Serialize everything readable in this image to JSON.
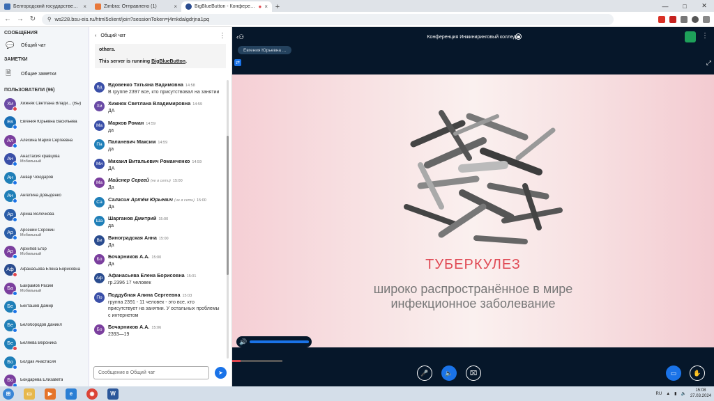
{
  "browser": {
    "tabs": [
      {
        "label": "Белгородский государственны",
        "color": "#3b6db3"
      },
      {
        "label": "Zimbra: Отправлено (1)",
        "color": "#e8783a"
      },
      {
        "label": "BigBlueButton - Конферен...",
        "color": "#2a4c8f"
      }
    ],
    "url": "ws228.bsu-eis.ru/html5client/join?sessionToken=j4mkdalgdrjna1pq"
  },
  "sidebar": {
    "messages_title": "СООБЩЕНИЯ",
    "public_chat": "Общий чат",
    "notes_title": "ЗАМЕТКИ",
    "shared_notes": "Общие заметки",
    "users_title": "ПОЛЬЗОВАТЕЛИ (96)",
    "users": [
      {
        "initials": "Хи",
        "name": "Хижняк Светлана Влади...  (Вы)",
        "sub": "",
        "color": "#6a4aa5",
        "dot": "#e0464d"
      },
      {
        "initials": "Ев",
        "name": "Евгения Юрьевна Васильева",
        "sub": "",
        "color": "#1a6fb5",
        "dot": "#1a73e8"
      },
      {
        "initials": "Ал",
        "name": "Алёхина Мария Сергеевна",
        "sub": "",
        "color": "#7b3f9e",
        "dot": "#1a73e8"
      },
      {
        "initials": "Ан",
        "name": "Анастасия кравцова",
        "sub": "Мобильный",
        "color": "#3a4fa8",
        "dot": "#1a73e8"
      },
      {
        "initials": "Ан",
        "name": "Анвар Чоюдаров",
        "sub": "",
        "color": "#1f7fb8",
        "dot": "#1a73e8"
      },
      {
        "initials": "Ан",
        "name": "Ангелина Довыденко",
        "sub": "",
        "color": "#1f7fb8",
        "dot": "#1a73e8"
      },
      {
        "initials": "Ар",
        "name": "Арина Волочкова",
        "sub": "",
        "color": "#2a5da8",
        "dot": "#1a73e8"
      },
      {
        "initials": "Ар",
        "name": "Арсений Сорокин",
        "sub": "Мобильный",
        "color": "#2a5da8",
        "dot": "#1a73e8"
      },
      {
        "initials": "Ар",
        "name": "Архипов Егор",
        "sub": "Мобильный",
        "color": "#7b3f9e",
        "dot": "#1a73e8"
      },
      {
        "initials": "Аф",
        "name": "Афанасьева Елена Борисовна",
        "sub": "",
        "color": "#2a4c8f",
        "dot": "#e0464d"
      },
      {
        "initials": "Ба",
        "name": "Байрамов Расим",
        "sub": "Мобильный",
        "color": "#7b3f9e",
        "dot": "#1a73e8"
      },
      {
        "initials": "Бе",
        "name": "Бекташев Дамир",
        "sub": "",
        "color": "#1f7fb8",
        "dot": "#1a73e8"
      },
      {
        "initials": "Бе",
        "name": "Белобородов Даниил",
        "sub": "",
        "color": "#1f7fb8",
        "dot": "#1a73e8"
      },
      {
        "initials": "Бе",
        "name": "Беляева Вероника",
        "sub": "",
        "color": "#1f7fb8",
        "dot": "#e0464d"
      },
      {
        "initials": "Бо",
        "name": "Болдак Анастасия",
        "sub": "",
        "color": "#1f7fb8",
        "dot": "#1a73e8"
      },
      {
        "initials": "Бо",
        "name": "Бондарева Елизавета",
        "sub": "",
        "color": "#7b3f9e",
        "dot": "#1a73e8"
      }
    ]
  },
  "chat": {
    "header": "Общий чат",
    "welcome_line1": "others.",
    "welcome_line2": "This server is running",
    "welcome_link": "BigBlueButton",
    "messages": [
      {
        "initials": "Вд",
        "name": "Вдовенко Татьяна Вадимовна",
        "offline": "",
        "time": "14:58",
        "text": "В группе 2397 все, кто присутствовал на занятии",
        "color": "#3a4fa8"
      },
      {
        "initials": "Хи",
        "name": "Хижняк Светлана Владимировна",
        "offline": "",
        "time": "14:59",
        "text": "ДА",
        "color": "#6a4aa5"
      },
      {
        "initials": "Ма",
        "name": "Марков Роман",
        "offline": "",
        "time": "14:59",
        "text": "да",
        "color": "#3a4fa8"
      },
      {
        "initials": "Па",
        "name": "Паланевич Максим",
        "offline": "",
        "time": "14:59",
        "text": "да",
        "color": "#1f7fb8"
      },
      {
        "initials": "Ми",
        "name": "Михаил Витальевич Романченко",
        "offline": "",
        "time": "14:59",
        "text": "ДА",
        "color": "#3a4fa8"
      },
      {
        "initials": "Ма",
        "name": "Майснер Сергей",
        "offline": "(не в сети)",
        "time": "15:00",
        "text": "Да",
        "color": "#7b3f9e"
      },
      {
        "initials": "Са",
        "name": "Саласин Артём Юрьевич",
        "offline": "(не в сети)",
        "time": "15:00",
        "text": "Да",
        "color": "#1f7fb8"
      },
      {
        "initials": "Ша",
        "name": "Шарганов Дмитрий",
        "offline": "",
        "time": "15:00",
        "text": "да",
        "color": "#1f7fb8"
      },
      {
        "initials": "Ви",
        "name": "Виноградская Анна",
        "offline": "",
        "time": "15:00",
        "text": "Да",
        "color": "#2a4c8f"
      },
      {
        "initials": "Бо",
        "name": "Бочарников А.А.",
        "offline": "",
        "time": "15:00",
        "text": "Да",
        "color": "#7b3f9e"
      },
      {
        "initials": "Аф",
        "name": "Афанасьева Елена Борисовна",
        "offline": "",
        "time": "15:01",
        "text": "гр.2396 17 человек",
        "color": "#2a4c8f"
      },
      {
        "initials": "По",
        "name": "Поддубная Алина Сергеевна",
        "offline": "",
        "time": "15:03",
        "text": "группа 2391 - 11 человек - это все, кто присутствует на занятии. У остальных проблемы с интернетом",
        "color": "#3a4fa8"
      },
      {
        "initials": "Бо",
        "name": "Бочарников А.А.",
        "offline": "",
        "time": "15:06",
        "text": "2393—19",
        "color": "#7b3f9e"
      }
    ],
    "input_placeholder": "Сообщение в Общий чат"
  },
  "conference": {
    "title": "Конференция Инжиниринговый колледж",
    "talker": "Евгения Юрьевна ...",
    "slide_title": "ТУБЕРКУЛЕЗ",
    "slide_sub1": "широко распространённое в мире",
    "slide_sub2": "инфекционное заболевание"
  },
  "taskbar": {
    "lang": "RU",
    "time": "15:08",
    "date": "27.03.2024"
  }
}
